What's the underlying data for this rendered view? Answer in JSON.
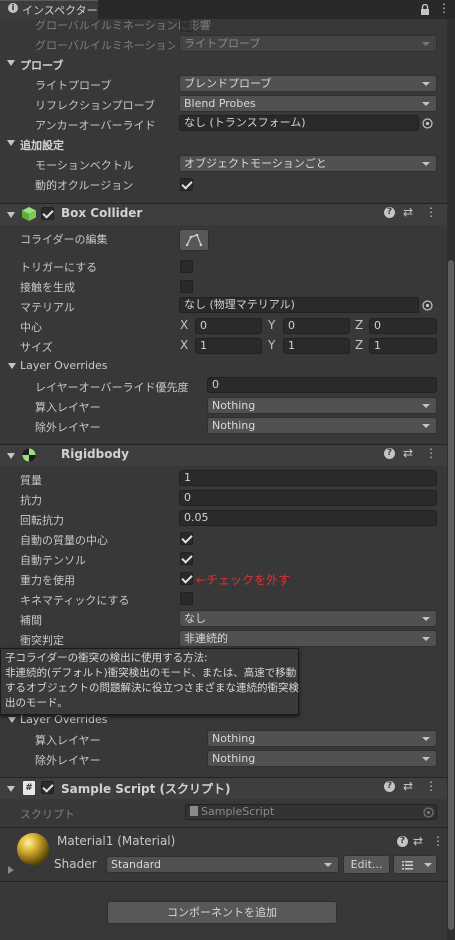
{
  "tab": {
    "title": "インスペクター",
    "icon": "info-icon"
  },
  "renderer": {
    "gi_label": "グローバルイルミネーションに影響",
    "gi_receive_label": "グローバルイルミネーションを受け取る",
    "gi_receive_value": "ライトプローブ"
  },
  "probes": {
    "title": "プローブ",
    "light_probe_label": "ライトプローブ",
    "light_probe_value": "ブレンドプローブ",
    "reflection_probe_label": "リフレクションプローブ",
    "reflection_probe_value": "Blend Probes",
    "anchor_label": "アンカーオーバーライド",
    "anchor_value": "なし (トランスフォーム)"
  },
  "additional": {
    "title": "追加設定",
    "motion_label": "モーションベクトル",
    "motion_value": "オブジェクトモーションごと",
    "occlusion_label": "動的オクルージョン"
  },
  "box_collider": {
    "title": "Box Collider",
    "edit_label": "コライダーの編集",
    "trigger_label": "トリガーにする",
    "contacts_label": "接触を生成",
    "material_label": "マテリアル",
    "material_value": "なし (物理マテリアル)",
    "center_label": "中心",
    "center": {
      "x": "0",
      "y": "0",
      "z": "0"
    },
    "size_label": "サイズ",
    "size": {
      "x": "1",
      "y": "1",
      "z": "1"
    },
    "axis_x": "X",
    "axis_y": "Y",
    "axis_z": "Z",
    "overrides_title": "Layer Overrides",
    "priority_label": "レイヤーオーバーライド優先度",
    "priority_value": "0",
    "include_label": "算入レイヤー",
    "include_value": "Nothing",
    "exclude_label": "除外レイヤー",
    "exclude_value": "Nothing"
  },
  "rigidbody": {
    "title": "Rigidbody",
    "mass_label": "質量",
    "mass_value": "1",
    "drag_label": "抗力",
    "drag_value": "0",
    "angular_drag_label": "回転抗力",
    "angular_drag_value": "0.05",
    "auto_com_label": "自動の質量の中心",
    "auto_tensor_label": "自動テンソル",
    "gravity_label": "重力を使用",
    "annotation": "←チェックを外す",
    "kinematic_label": "キネマティックにする",
    "interpolate_label": "補間",
    "interpolate_value": "なし",
    "collision_label": "衝突判定",
    "collision_value": "非連続的",
    "overrides_title": "Layer Overrides",
    "include_label": "算入レイヤー",
    "include_value": "Nothing",
    "exclude_label": "除外レイヤー",
    "exclude_value": "Nothing"
  },
  "tooltip": {
    "line1": "子コライダーの衝突の検出に使用する方法:",
    "line2": "非連続的(デフォルト)衝突検出のモード、または、高速で移動",
    "line3": "するオブジェクトの問題解決に役立つさまざまな連続的衝突検",
    "line4": "出のモード。"
  },
  "script": {
    "title": "Sample Script (スクリプト)",
    "script_label": "スクリプト",
    "script_value": "SampleScript"
  },
  "material": {
    "title": "Material1 (Material)",
    "shader_label": "Shader",
    "shader_value": "Standard",
    "edit_button": "Edit...",
    "list_icon": "list-icon"
  },
  "add_component": "コンポーネントを追加",
  "colors": {
    "annotation": "#e03030",
    "header_bg": "#3e3e3e",
    "panel_bg": "#383838"
  }
}
